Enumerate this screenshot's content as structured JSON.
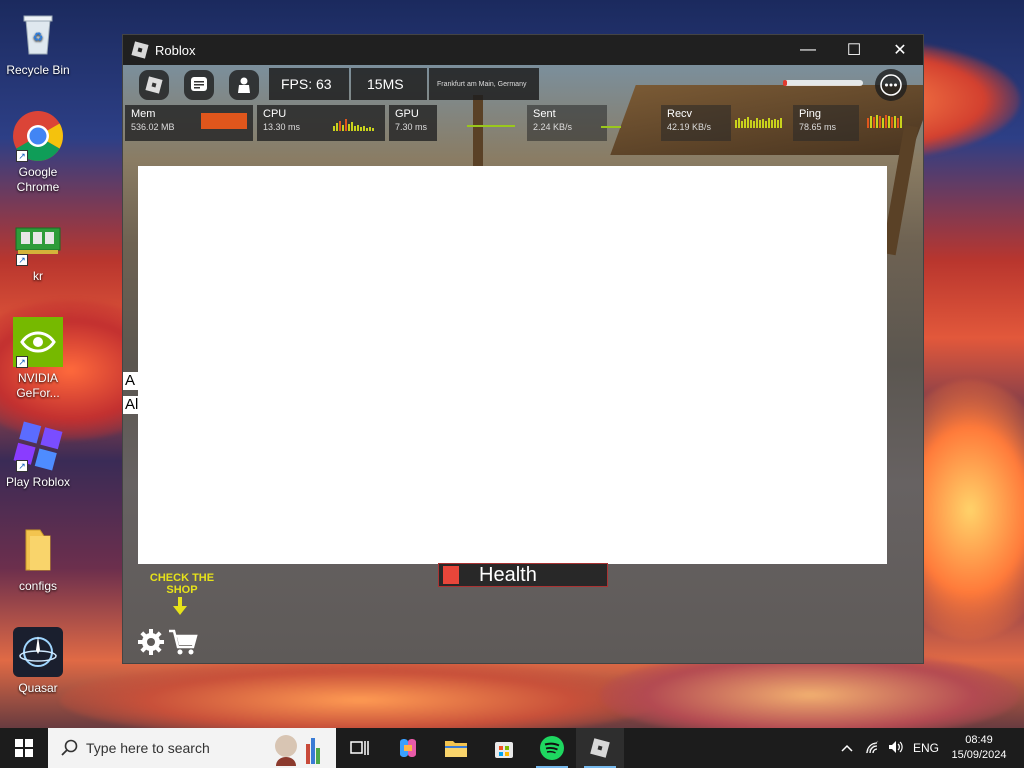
{
  "desktop": {
    "icons": [
      {
        "label": "Recycle Bin"
      },
      {
        "label": "Google Chrome"
      },
      {
        "label": "kr"
      },
      {
        "label": "NVIDIA GeFor..."
      },
      {
        "label": "Play Roblox"
      },
      {
        "label": "configs"
      },
      {
        "label": "Quasar"
      }
    ]
  },
  "window": {
    "title": "Roblox",
    "controls": {
      "minimize": "—",
      "maximize": "☐",
      "close": "✕"
    }
  },
  "game": {
    "topbar": {
      "fps": "FPS: 63",
      "latency": "15MS",
      "location": "Frankfurt am Main, Germany",
      "volume_level": 0.02
    },
    "stats": {
      "mem": {
        "label": "Mem",
        "value": "536.02 MB"
      },
      "cpu": {
        "label": "CPU",
        "value": "13.30 ms"
      },
      "gpu": {
        "label": "GPU",
        "value": "7.30 ms"
      },
      "sent": {
        "label": "Sent",
        "value": "2.24 KB/s"
      },
      "recv": {
        "label": "Recv",
        "value": "42.19 KB/s"
      },
      "ping": {
        "label": "Ping",
        "value": "78.65 ms"
      }
    },
    "edge_letters": [
      "A",
      "Al"
    ],
    "health_label": "Health",
    "shop_hint": "CHECK THE SHOP"
  },
  "taskbar": {
    "search_placeholder": "Type here to search",
    "language": "ENG",
    "time": "08:49",
    "date": "15/09/2024"
  },
  "colors": {
    "health_red": "#e8463a",
    "shop_yellow": "#e6e21a",
    "spark_yellow": "#c9d21c",
    "mem_orange": "#e0561c"
  }
}
